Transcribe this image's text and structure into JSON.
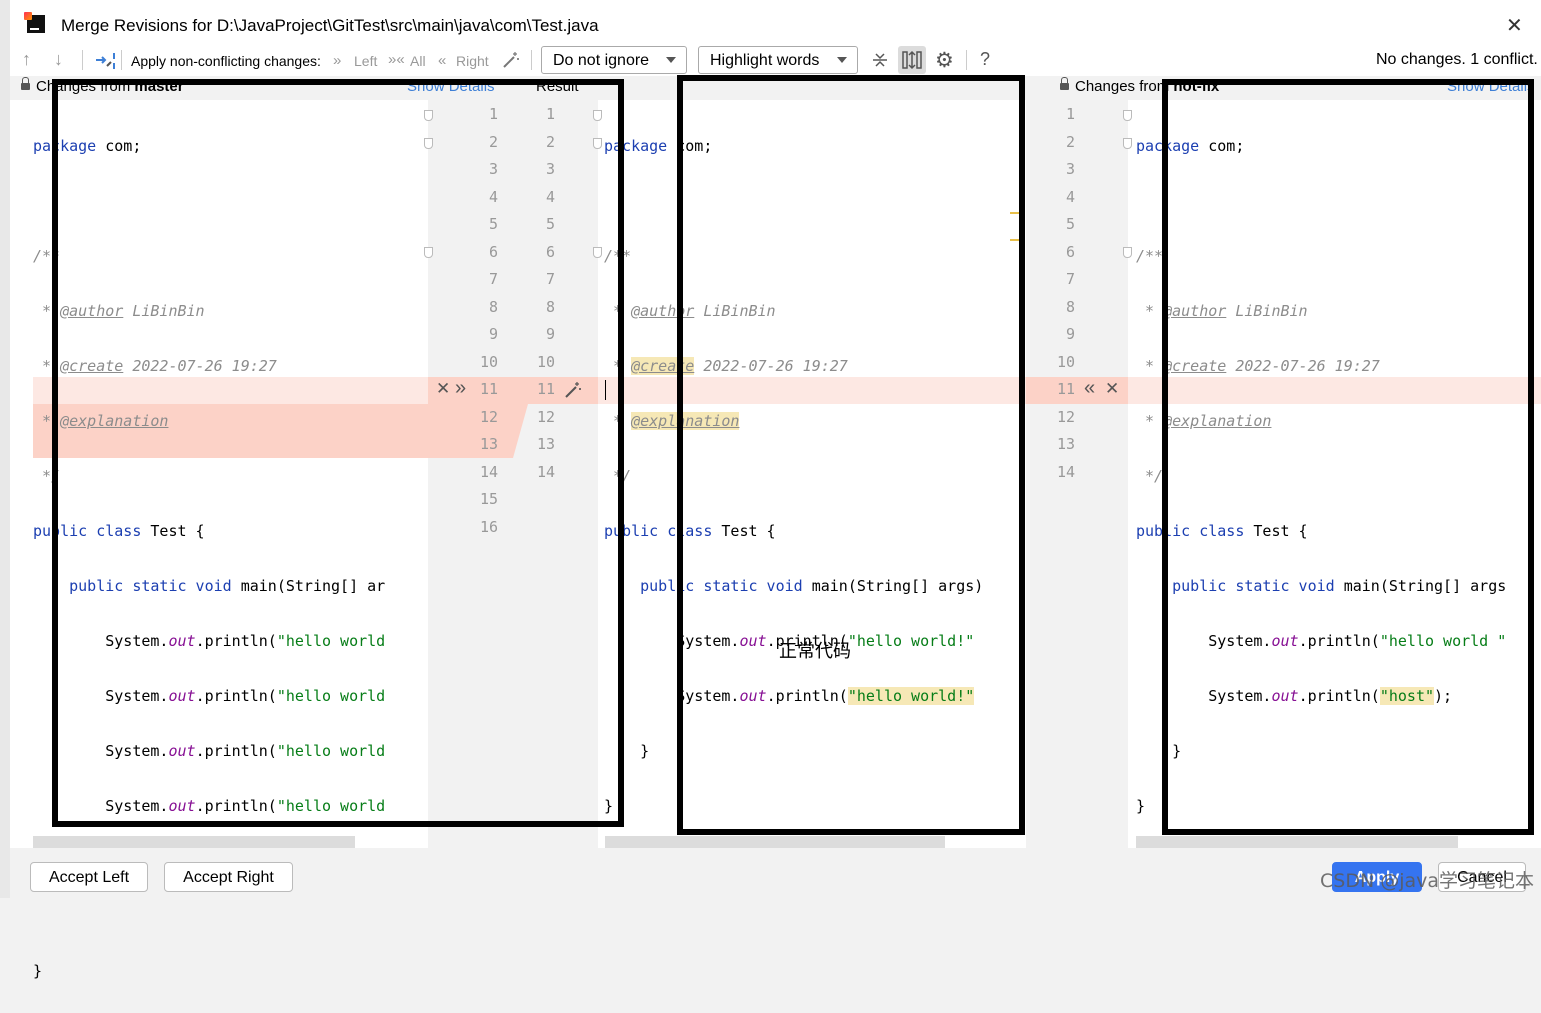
{
  "window": {
    "title": "Merge Revisions for D:\\JavaProject\\GitTest\\src\\main\\java\\com\\Test.java",
    "close_glyph": "✕"
  },
  "toolbar": {
    "prev_glyph": "↑",
    "next_glyph": "↓",
    "apply_label": "Apply non-conflicting changes:",
    "left_label": "Left",
    "all_label": "All",
    "right_label": "Right",
    "ignore_combo": "Do not ignore",
    "highlight_combo": "Highlight words",
    "help_glyph": "?",
    "status": "No changes. 1 conflict."
  },
  "headers": {
    "left_prefix": "Changes from ",
    "left_branch": "master",
    "left_show_details": "Show Details",
    "result": "Result",
    "right_prefix": "Changes from ",
    "right_branch": "hot-fix",
    "right_show_details": "Show Details"
  },
  "left_line_numbers": [
    "1",
    "2",
    "3",
    "4",
    "5",
    "6",
    "7",
    "8",
    "9",
    "10",
    "11",
    "12",
    "13",
    "14",
    "15",
    "16"
  ],
  "result_line_numbers": [
    "1",
    "2",
    "3",
    "4",
    "5",
    "6",
    "7",
    "8",
    "9",
    "10",
    "11",
    "12",
    "13",
    "14"
  ],
  "right_line_numbers": [
    "1",
    "2",
    "3",
    "4",
    "5",
    "6",
    "7",
    "8",
    "9",
    "10",
    "11",
    "12",
    "13",
    "14"
  ],
  "code_common": {
    "package_kw": "package",
    "package_rest": " com;",
    "comment_open": "/**",
    "star": " * ",
    "author_tag": "@author",
    "author_val": " LiBinBin",
    "create_tag": "@create",
    "create_val": " 2022-07-26 19:27",
    "expl_tag": "@explanation",
    "comment_close": " */",
    "class_kw1": "public",
    "class_kw2": " class",
    "class_rest": " Test {",
    "main_kw": "public static void",
    "main_rest_left": " main(String[] ar",
    "main_rest_mid": " main(String[] args)",
    "main_rest_right": " main(String[] args",
    "sys": "System.",
    "out": "out",
    "println": ".println(",
    "hw_left": "\"hello world",
    "hw_mid": "\"hello world!\"",
    "hw_right": "\"hello world \"",
    "host": "\"host\"",
    "host_end": ");",
    "brace_close_inner": "}",
    "brace_close_outer": "}"
  },
  "annotation_text": "正常代码",
  "buttons": {
    "accept_left": "Accept Left",
    "accept_right": "Accept Right",
    "apply": "Apply",
    "cancel": "Cancel"
  },
  "watermark": "CSDN @java学习笔记本",
  "colors": {
    "conflict": "#fcd2c7",
    "keyword": "#1c3fb1",
    "string": "#067d17",
    "link": "#3d7fd6",
    "apply_btn": "#3574f0"
  }
}
